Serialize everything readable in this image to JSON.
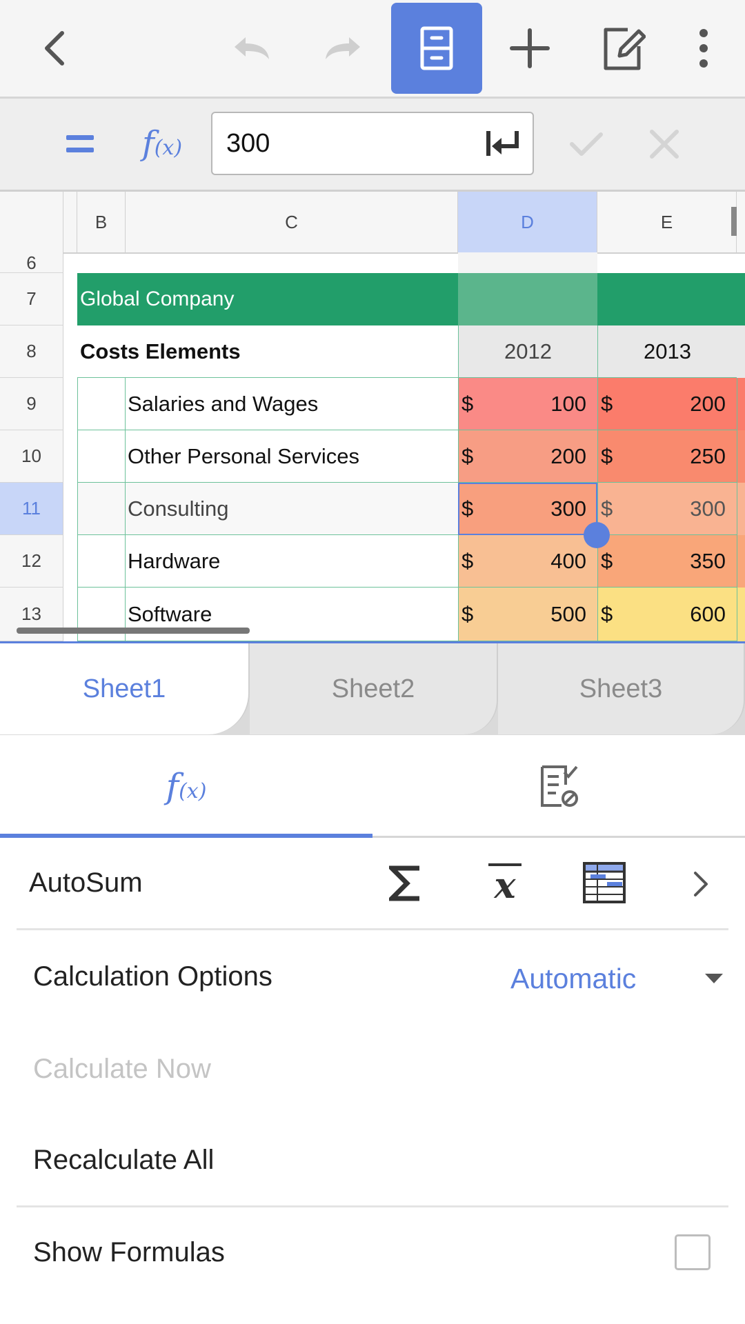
{
  "toolbar": {
    "buttons": [
      {
        "name": "back-button",
        "icon": "chevron-left-icon"
      },
      {
        "name": "undo-button",
        "icon": "undo-icon"
      },
      {
        "name": "redo-button",
        "icon": "redo-icon"
      },
      {
        "name": "file-cabinet-button",
        "icon": "file-cabinet-icon",
        "active": true
      },
      {
        "name": "insert-button",
        "icon": "plus-icon"
      },
      {
        "name": "edit-button",
        "icon": "edit-icon"
      },
      {
        "name": "more-button",
        "icon": "more-vertical-icon"
      }
    ]
  },
  "formula_bar": {
    "equals_icon": "equals-icon",
    "fx_label": "f(x)",
    "value": "300",
    "enter_icon": "enter-icon",
    "confirm_icon": "checkmark-icon",
    "cancel_icon": "close-icon"
  },
  "sheet": {
    "columns": [
      "B",
      "C",
      "D",
      "E"
    ],
    "selected_column": "D",
    "rows": [
      "6",
      "7",
      "8",
      "9",
      "10",
      "11",
      "12",
      "13"
    ],
    "selected_row": "11",
    "banner": "Global Company",
    "header_label": "Costs Elements",
    "years": [
      "2012",
      "2013"
    ],
    "currency": "$",
    "items": [
      {
        "label": "Salaries and Wages",
        "d": "100",
        "e": "200"
      },
      {
        "label": "Other Personal Services",
        "d": "200",
        "e": "250"
      },
      {
        "label": "Consulting",
        "d": "300",
        "e": "300"
      },
      {
        "label": "Hardware",
        "d": "400",
        "e": "350"
      },
      {
        "label": "Software",
        "d": "500",
        "e": "600"
      }
    ],
    "colors": {
      "banner": "#229e6a",
      "d_fills": [
        "#fa8a86",
        "#f79d84",
        "#f89f7e",
        "#f8bf93",
        "#f8cd94"
      ],
      "e_fills": [
        "#fb7c6b",
        "#f98a6e",
        "#f9b392",
        "#f9a679",
        "#fbe083"
      ]
    }
  },
  "sheet_tabs": [
    {
      "label": "Sheet1",
      "active": true
    },
    {
      "label": "Sheet2",
      "active": false
    },
    {
      "label": "Sheet3",
      "active": false
    }
  ],
  "panel": {
    "tabs": [
      {
        "icon": "function-icon",
        "label": "f(x)",
        "active": true
      },
      {
        "icon": "formula-audit-icon",
        "active": false
      }
    ],
    "autosum_label": "AutoSum",
    "autosum_icons": [
      "sigma-icon",
      "average-icon",
      "table-icon",
      "chevron-right-icon"
    ],
    "calc_options_label": "Calculation Options",
    "calc_options_value": "Automatic",
    "calculate_now_label": "Calculate Now",
    "recalculate_all_label": "Recalculate All",
    "show_formulas_label": "Show Formulas",
    "show_formulas_checked": false,
    "accent_color": "#5b80dd"
  }
}
